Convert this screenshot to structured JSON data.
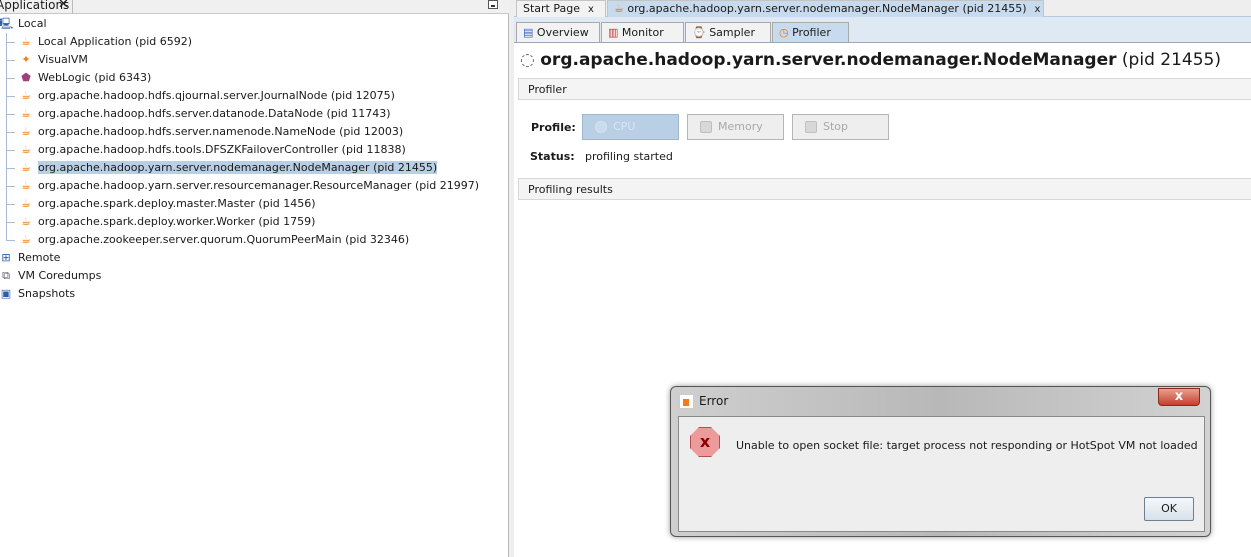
{
  "applications_panel": {
    "title": "Applications",
    "close_glyph": "✕",
    "root": {
      "label": "Local",
      "icon": "computer-icon"
    },
    "local_items": [
      {
        "label": "Local Application (pid 6592)",
        "icon": "java-icon"
      },
      {
        "label": "VisualVM",
        "icon": "visualvm-icon"
      },
      {
        "label": "WebLogic (pid 6343)",
        "icon": "weblogic-icon"
      },
      {
        "label": "org.apache.hadoop.hdfs.qjournal.server.JournalNode (pid 12075)",
        "icon": "java-icon"
      },
      {
        "label": "org.apache.hadoop.hdfs.server.datanode.DataNode (pid 11743)",
        "icon": "java-icon"
      },
      {
        "label": "org.apache.hadoop.hdfs.server.namenode.NameNode (pid 12003)",
        "icon": "java-icon"
      },
      {
        "label": "org.apache.hadoop.hdfs.tools.DFSZKFailoverController (pid 11838)",
        "icon": "java-icon"
      },
      {
        "label": "org.apache.hadoop.yarn.server.nodemanager.NodeManager (pid 21455)",
        "icon": "java-icon",
        "selected": true
      },
      {
        "label": "org.apache.hadoop.yarn.server.resourcemanager.ResourceManager (pid 21997)",
        "icon": "java-icon"
      },
      {
        "label": "org.apache.spark.deploy.master.Master (pid 1456)",
        "icon": "java-icon"
      },
      {
        "label": "org.apache.spark.deploy.worker.Worker (pid 1759)",
        "icon": "java-icon"
      },
      {
        "label": "org.apache.zookeeper.server.quorum.QuorumPeerMain (pid 32346)",
        "icon": "java-icon"
      }
    ],
    "other_roots": [
      {
        "label": "Remote",
        "icon": "remote-icon"
      },
      {
        "label": "VM Coredumps",
        "icon": "coredump-icon"
      },
      {
        "label": "Snapshots",
        "icon": "snapshot-icon"
      }
    ]
  },
  "editor_tabs": [
    {
      "label": "Start Page",
      "close": "x"
    },
    {
      "label": "org.apache.hadoop.yarn.server.nodemanager.NodeManager (pid 21455)",
      "close": "x",
      "active": true
    }
  ],
  "sub_tabs": [
    {
      "label": "Overview"
    },
    {
      "label": "Monitor"
    },
    {
      "label": "Sampler"
    },
    {
      "label": "Profiler",
      "active": true
    }
  ],
  "main": {
    "title_bold": "org.apache.hadoop.yarn.server.nodemanager.NodeManager",
    "title_pid": "(pid 21455)",
    "profiler_section": "Profiler",
    "profile_label": "Profile:",
    "buttons": {
      "cpu": "CPU",
      "memory": "Memory",
      "stop": "Stop"
    },
    "status_label": "Status:",
    "status_value": "profiling started",
    "results_section": "Profiling results"
  },
  "dialog": {
    "title": "Error",
    "close_glyph": "x",
    "error_glyph": "x",
    "message": "Unable to open socket file: target process not responding or HotSpot VM not loaded",
    "ok": "OK"
  },
  "colors": {
    "selection": "#b8cfe5",
    "active_tab": "#c8dbee",
    "error": "#c4402c"
  }
}
